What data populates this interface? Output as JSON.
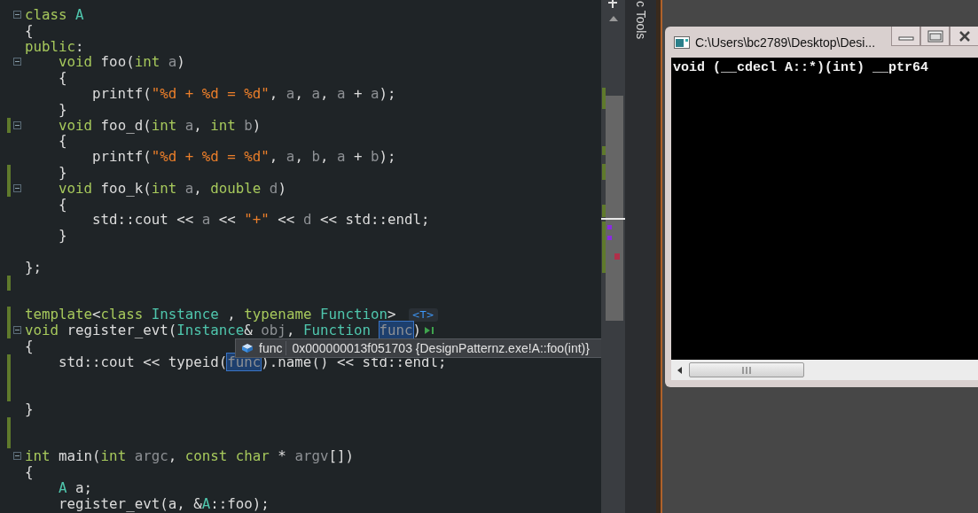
{
  "editor": {
    "lines": [
      {
        "modified": false,
        "foldable": true,
        "segments": [
          {
            "kind": "kw",
            "text": "class "
          },
          {
            "kind": "type",
            "text": "A"
          }
        ]
      },
      {
        "modified": false,
        "segments": [
          {
            "kind": "plain",
            "text": "{"
          }
        ]
      },
      {
        "modified": false,
        "segments": [
          {
            "kind": "kw",
            "text": "public"
          },
          {
            "kind": "plain",
            "text": ":"
          }
        ]
      },
      {
        "modified": false,
        "foldable": true,
        "segments": [
          {
            "kind": "kw",
            "text": "    void "
          },
          {
            "kind": "plain",
            "text": "foo("
          },
          {
            "kind": "kw",
            "text": "int "
          },
          {
            "kind": "param",
            "text": "a"
          },
          {
            "kind": "plain",
            "text": ")"
          }
        ]
      },
      {
        "modified": false,
        "segments": [
          {
            "kind": "plain",
            "text": "    {"
          }
        ]
      },
      {
        "modified": false,
        "segments": [
          {
            "kind": "plain",
            "text": "        printf("
          },
          {
            "kind": "str",
            "text": "\"%d + %d = %d\""
          },
          {
            "kind": "plain",
            "text": ", "
          },
          {
            "kind": "param",
            "text": "a"
          },
          {
            "kind": "plain",
            "text": ", "
          },
          {
            "kind": "param",
            "text": "a"
          },
          {
            "kind": "plain",
            "text": ", "
          },
          {
            "kind": "param",
            "text": "a"
          },
          {
            "kind": "plain",
            "text": " + "
          },
          {
            "kind": "param",
            "text": "a"
          },
          {
            "kind": "plain",
            "text": ");"
          }
        ]
      },
      {
        "modified": false,
        "segments": [
          {
            "kind": "plain",
            "text": "    }"
          }
        ]
      },
      {
        "modified": true,
        "foldable": true,
        "segments": [
          {
            "kind": "kw",
            "text": "    void "
          },
          {
            "kind": "plain",
            "text": "foo_d("
          },
          {
            "kind": "kw",
            "text": "int "
          },
          {
            "kind": "param",
            "text": "a"
          },
          {
            "kind": "plain",
            "text": ", "
          },
          {
            "kind": "kw",
            "text": "int "
          },
          {
            "kind": "param",
            "text": "b"
          },
          {
            "kind": "plain",
            "text": ")"
          }
        ]
      },
      {
        "modified": false,
        "segments": [
          {
            "kind": "plain",
            "text": "    {"
          }
        ]
      },
      {
        "modified": false,
        "segments": [
          {
            "kind": "plain",
            "text": "        printf("
          },
          {
            "kind": "str",
            "text": "\"%d + %d = %d\""
          },
          {
            "kind": "plain",
            "text": ", "
          },
          {
            "kind": "param",
            "text": "a"
          },
          {
            "kind": "plain",
            "text": ", "
          },
          {
            "kind": "param",
            "text": "b"
          },
          {
            "kind": "plain",
            "text": ", "
          },
          {
            "kind": "param",
            "text": "a"
          },
          {
            "kind": "plain",
            "text": " + "
          },
          {
            "kind": "param",
            "text": "b"
          },
          {
            "kind": "plain",
            "text": ");"
          }
        ]
      },
      {
        "modified": true,
        "segments": [
          {
            "kind": "plain",
            "text": "    }"
          }
        ]
      },
      {
        "modified": true,
        "foldable": true,
        "segments": [
          {
            "kind": "kw",
            "text": "    void "
          },
          {
            "kind": "plain",
            "text": "foo_k("
          },
          {
            "kind": "kw",
            "text": "int "
          },
          {
            "kind": "param",
            "text": "a"
          },
          {
            "kind": "plain",
            "text": ", "
          },
          {
            "kind": "kw",
            "text": "double "
          },
          {
            "kind": "param",
            "text": "d"
          },
          {
            "kind": "plain",
            "text": ")"
          }
        ]
      },
      {
        "modified": false,
        "segments": [
          {
            "kind": "plain",
            "text": "    {"
          }
        ]
      },
      {
        "modified": false,
        "segments": [
          {
            "kind": "plain",
            "text": "        std::cout << "
          },
          {
            "kind": "param",
            "text": "a"
          },
          {
            "kind": "plain",
            "text": " << "
          },
          {
            "kind": "str",
            "text": "\"+\""
          },
          {
            "kind": "plain",
            "text": " << "
          },
          {
            "kind": "param",
            "text": "d"
          },
          {
            "kind": "plain",
            "text": " << std::endl;"
          }
        ]
      },
      {
        "modified": false,
        "segments": [
          {
            "kind": "plain",
            "text": "    }"
          }
        ]
      },
      {
        "modified": false
      },
      {
        "modified": false,
        "segments": [
          {
            "kind": "plain",
            "text": "};"
          }
        ]
      },
      {
        "modified": true
      },
      {
        "modified": false
      },
      {
        "modified": true,
        "hint": "<T>",
        "segments": [
          {
            "kind": "kw",
            "text": "template"
          },
          {
            "kind": "plain",
            "text": "<"
          },
          {
            "kind": "kw",
            "text": "class "
          },
          {
            "kind": "type",
            "text": "Instance"
          },
          {
            "kind": "plain",
            "text": " , "
          },
          {
            "kind": "kw",
            "text": "typename "
          },
          {
            "kind": "type",
            "text": "Function"
          },
          {
            "kind": "plain",
            "text": ">"
          }
        ]
      },
      {
        "modified": true,
        "foldable": true,
        "run_marker": true,
        "segments": [
          {
            "kind": "kw",
            "text": "void "
          },
          {
            "kind": "plain",
            "text": "register_evt("
          },
          {
            "kind": "type",
            "text": "Instance"
          },
          {
            "kind": "plain",
            "text": "& "
          },
          {
            "kind": "param",
            "text": "obj"
          },
          {
            "kind": "plain",
            "text": ", "
          },
          {
            "kind": "type",
            "text": "Function "
          },
          {
            "kind": "hl",
            "text": "func"
          },
          {
            "kind": "plain",
            "text": ")"
          }
        ]
      },
      {
        "modified": false,
        "segments": [
          {
            "kind": "plain",
            "text": "{"
          }
        ]
      },
      {
        "modified": true,
        "segments": [
          {
            "kind": "plain",
            "text": "    std::cout << typeid("
          },
          {
            "kind": "hl",
            "text": "func"
          },
          {
            "kind": "plain",
            "text": ").name() << std::endl;"
          }
        ]
      },
      {
        "modified": true
      },
      {
        "modified": true
      },
      {
        "modified": false,
        "segments": [
          {
            "kind": "plain",
            "text": "}"
          }
        ]
      },
      {
        "modified": true
      },
      {
        "modified": true
      },
      {
        "modified": false,
        "foldable": true,
        "segments": [
          {
            "kind": "kw",
            "text": "int "
          },
          {
            "kind": "plain",
            "text": "main("
          },
          {
            "kind": "kw",
            "text": "int "
          },
          {
            "kind": "param",
            "text": "argc"
          },
          {
            "kind": "plain",
            "text": ", "
          },
          {
            "kind": "kw",
            "text": "const char "
          },
          {
            "kind": "plain",
            "text": "* "
          },
          {
            "kind": "param",
            "text": "argv"
          },
          {
            "kind": "plain",
            "text": "[])"
          }
        ]
      },
      {
        "modified": false,
        "segments": [
          {
            "kind": "plain",
            "text": "{"
          }
        ]
      },
      {
        "modified": false,
        "segments": [
          {
            "kind": "type",
            "text": "    A"
          },
          {
            "kind": "plain",
            "text": " a;"
          }
        ]
      },
      {
        "modified": false,
        "segments": [
          {
            "kind": "plain",
            "text": "    register_evt(a, &"
          },
          {
            "kind": "type",
            "text": "A"
          },
          {
            "kind": "plain",
            "text": "::foo);"
          }
        ]
      }
    ]
  },
  "tooltip": {
    "name": "func",
    "value": "0x000000013f051703 {DesignPatternz.exe!A::foo(int)}"
  },
  "side_panel": {
    "title": "c Tools"
  },
  "console": {
    "title": "C:\\Users\\bc2789\\Desktop\\Desi...",
    "output": "void (__cdecl A::*)(int) __ptr64"
  }
}
